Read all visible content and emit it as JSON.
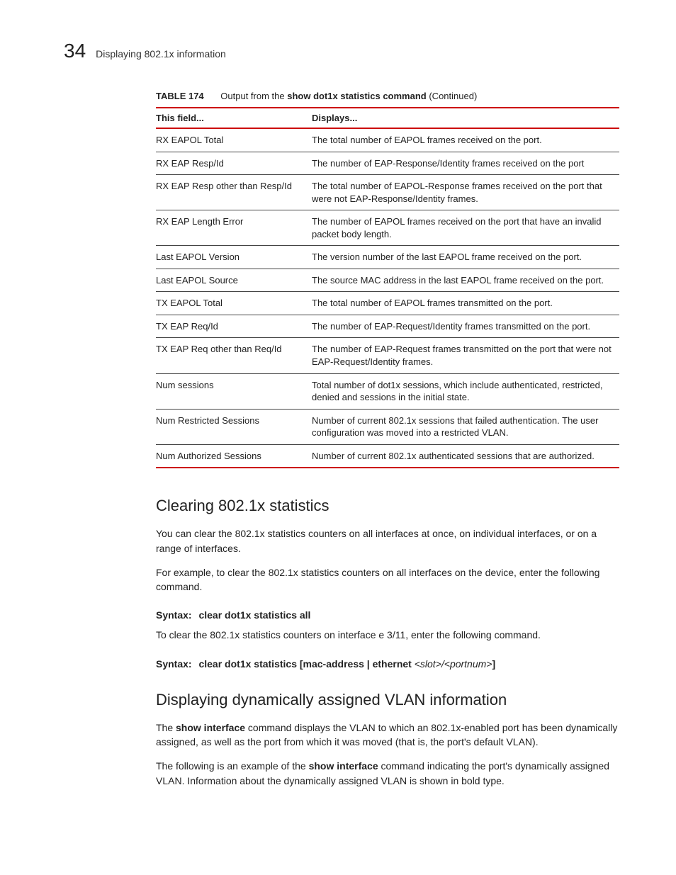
{
  "header": {
    "page_number": "34",
    "section_title": "Displaying 802.1x information"
  },
  "table": {
    "label": "TABLE 174",
    "caption_prefix": "Output from the ",
    "caption_bold": "show dot1x statistics command",
    "caption_suffix": "  (Continued)",
    "head_field": "This field...",
    "head_displays": "Displays...",
    "rows": [
      {
        "field": "RX EAPOL Total",
        "desc": "The total number of EAPOL frames received on the port."
      },
      {
        "field": "RX EAP Resp/Id",
        "desc": "The number of EAP-Response/Identity frames received on the port"
      },
      {
        "field": "RX EAP Resp other than Resp/Id",
        "desc": "The total number of EAPOL-Response frames received on the port that were not EAP-Response/Identity frames."
      },
      {
        "field": "RX EAP Length Error",
        "desc": "The number of EAPOL frames received on the port that have an invalid packet body length."
      },
      {
        "field": "Last EAPOL Version",
        "desc": "The version number of the last EAPOL frame received on the port."
      },
      {
        "field": "Last EAPOL Source",
        "desc": "The source MAC address in the last EAPOL frame received on the port."
      },
      {
        "field": "TX EAPOL Total",
        "desc": "The total number of EAPOL frames transmitted on the port."
      },
      {
        "field": "TX EAP Req/Id",
        "desc": "The number of EAP-Request/Identity frames transmitted on the port."
      },
      {
        "field": "TX EAP Req other than Req/Id",
        "desc": "The number of EAP-Request frames transmitted on the port that were not EAP-Request/Identity frames."
      },
      {
        "field": "Num sessions",
        "desc": "Total number of dot1x sessions, which include authenticated, restricted, denied and sessions in the initial state."
      },
      {
        "field": "Num Restricted Sessions",
        "desc": "Number of current 802.1x sessions that failed authentication. The user configuration was moved into a restricted VLAN."
      },
      {
        "field": "Num Authorized Sessions",
        "desc": "Number of current 802.1x authenticated sessions that are authorized."
      }
    ]
  },
  "sections": {
    "clearing_title": "Clearing 802.1x statistics",
    "clearing_p1": "You can clear the 802.1x statistics counters on all interfaces at once, on individual interfaces, or on a range of interfaces.",
    "clearing_p2": "For example, to clear the 802.1x statistics counters on all interfaces on the device, enter the following command.",
    "syntax_label": "Syntax:",
    "syntax1_cmd": "clear dot1x statistics all",
    "clearing_p3": "To clear the 802.1x statistics counters on interface e 3/11, enter the following command.",
    "syntax2_cmd": "clear dot1x statistics [mac-address | ethernet ",
    "syntax2_param": "<slot>/<portnum>",
    "syntax2_tail": "]",
    "vlan_title": "Displaying dynamically assigned VLAN information",
    "vlan_p1_pre": "The ",
    "vlan_p1_bold": "show interface",
    "vlan_p1_post": " command displays the VLAN to which an 802.1x-enabled port has been dynamically assigned, as well as the port from which it was moved (that is, the port's default VLAN).",
    "vlan_p2_pre": "The following is an example of the ",
    "vlan_p2_bold": "show interface",
    "vlan_p2_post": " command indicating the port's dynamically assigned VLAN.  Information about the dynamically assigned VLAN is shown in bold type."
  }
}
